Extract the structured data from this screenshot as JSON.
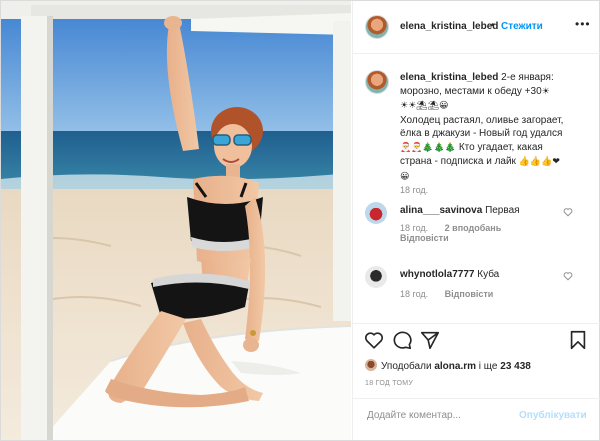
{
  "colors": {
    "accent": "#0095f6",
    "muted": "#8e8e8e",
    "text": "#262626",
    "border": "#dbdbdb",
    "publish_disabled": "#b2dffc"
  },
  "post": {
    "photo_name": "beach-photo"
  },
  "header": {
    "username": "elena_kristina_lebed",
    "separator": "•",
    "follow_label": "Стежити",
    "more_icon": "more-dots-icon"
  },
  "caption": {
    "username": "elena_kristina_lebed",
    "line1": "2-е января:",
    "line2": "морозно, местами к обеду +30",
    "emoji_1": "☀",
    "line3_emoji": "☀☀⛱⛱😀",
    "line4": "Холодец растаял, оливье загорает,",
    "line5": "ёлка в джакузи - Новый год удался",
    "line6_emoji": "🎅🎅🎄🎄🎄",
    "line6_text": "Кто угадает, какая",
    "line7_text": "страна - подписка и лайк",
    "line7_emoji": "👍👍👍❤",
    "line8_emoji": "😀",
    "time": "18 год."
  },
  "comments": [
    {
      "username": "alina___savinova",
      "text": "Первая",
      "time": "18 год.",
      "likes": "2 вподобань",
      "reply": "Відповісти",
      "like_icon": "heart-outline-icon"
    },
    {
      "username": "whynotlola7777",
      "text": "Куба",
      "time": "18 год.",
      "reply": "Відповісти",
      "like_icon": "heart-outline-icon"
    }
  ],
  "actions": {
    "like_icon": "heart-icon",
    "comment_icon": "comment-icon",
    "share_icon": "share-icon",
    "save_icon": "bookmark-icon",
    "liked_by_prefix": "Уподобали",
    "liked_by_user": "alona.rm",
    "liked_by_and": "і ще",
    "liked_by_count": "23 438",
    "time_ago": "18 ГОД ТОМУ"
  },
  "comment_form": {
    "placeholder": "Додайте коментар...",
    "publish_label": "Опублікувати"
  }
}
